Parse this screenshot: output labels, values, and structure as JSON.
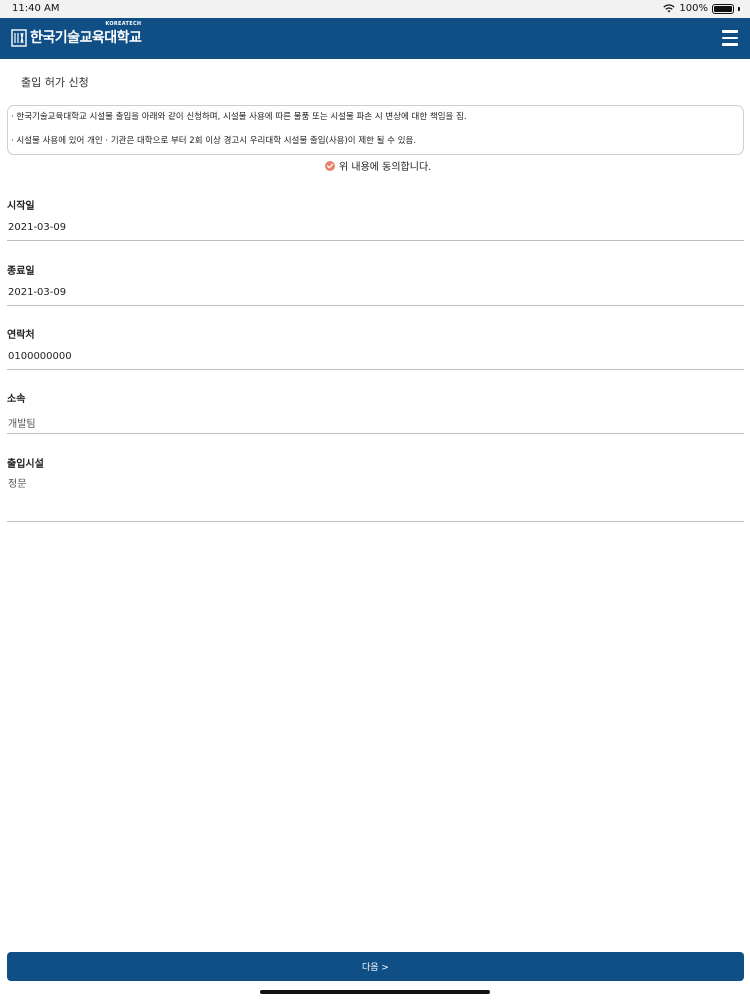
{
  "status_bar": {
    "time": "11:40 AM",
    "battery": "100%"
  },
  "header": {
    "logo_sub": "KOREATECH",
    "logo_name": "한국기술교육대학교"
  },
  "page": {
    "title": "출입 허가 신청"
  },
  "notice": {
    "lines": [
      "· 한국기술교육대학교 시설물 출입을 아래와 같이 신청하며, 시설물 사용에 따른 물품 또는 시설물 파손 시 변상에 대한 책임을 짐.",
      "· 시설물 사용에 있어 개인 · 기관은 대학으로 부터 2회 이상 경고시 우리대학 시설물 출입(사용)이 제한 될 수 있음."
    ]
  },
  "agree": {
    "label": "위 내용에 동의합니다.",
    "checked": true,
    "color": "#e8836b"
  },
  "fields": {
    "start_date": {
      "label": "시작일",
      "value": "2021-03-09"
    },
    "end_date": {
      "label": "종료일",
      "value": "2021-03-09"
    },
    "contact": {
      "label": "연락처",
      "value": "0100000000"
    },
    "affiliation": {
      "label": "소속",
      "value": "개발팀"
    },
    "facility": {
      "label": "출입시설",
      "value": "정문"
    }
  },
  "actions": {
    "next_label": "다음 >"
  },
  "colors": {
    "primary": "#104f86"
  }
}
